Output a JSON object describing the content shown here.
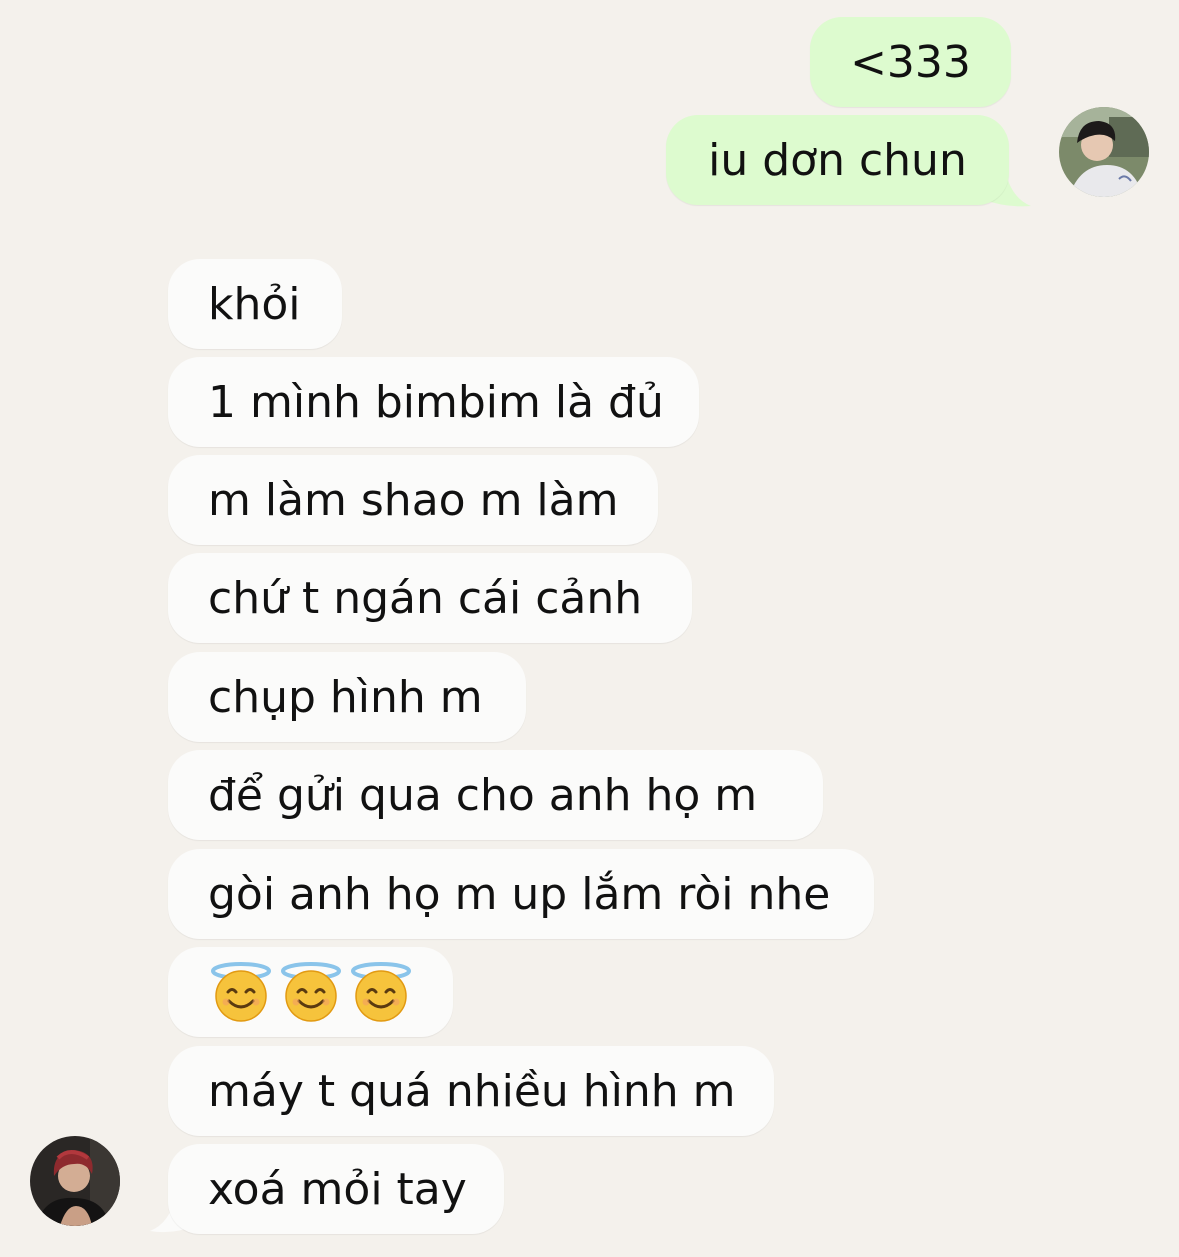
{
  "colors": {
    "background": "#f4f1ec",
    "outgoing_bubble": "#ddfbcf",
    "incoming_bubble": "#fbfbfa",
    "text": "#111111"
  },
  "outgoing_messages": [
    {
      "text": "<333"
    },
    {
      "text": "iu dơn chun"
    }
  ],
  "incoming_messages": [
    {
      "text": "khỏi"
    },
    {
      "text": "1 mình bimbim là đủ"
    },
    {
      "text": "m làm shao m làm"
    },
    {
      "text": "chứ t ngán cái cảnh"
    },
    {
      "text": "chụp hình m"
    },
    {
      "text": "để gửi qua cho anh họ m"
    },
    {
      "text": "gòi anh họ m up lắm ròi nhe"
    },
    {
      "emoji": [
        "smiling-face-with-halo",
        "smiling-face-with-halo",
        "smiling-face-with-halo"
      ]
    },
    {
      "text": "máy t quá nhiều hình m"
    },
    {
      "text": "xoá mỏi tay"
    }
  ],
  "avatars": {
    "self": "self-avatar-photo",
    "contact": "contact-avatar-photo"
  }
}
